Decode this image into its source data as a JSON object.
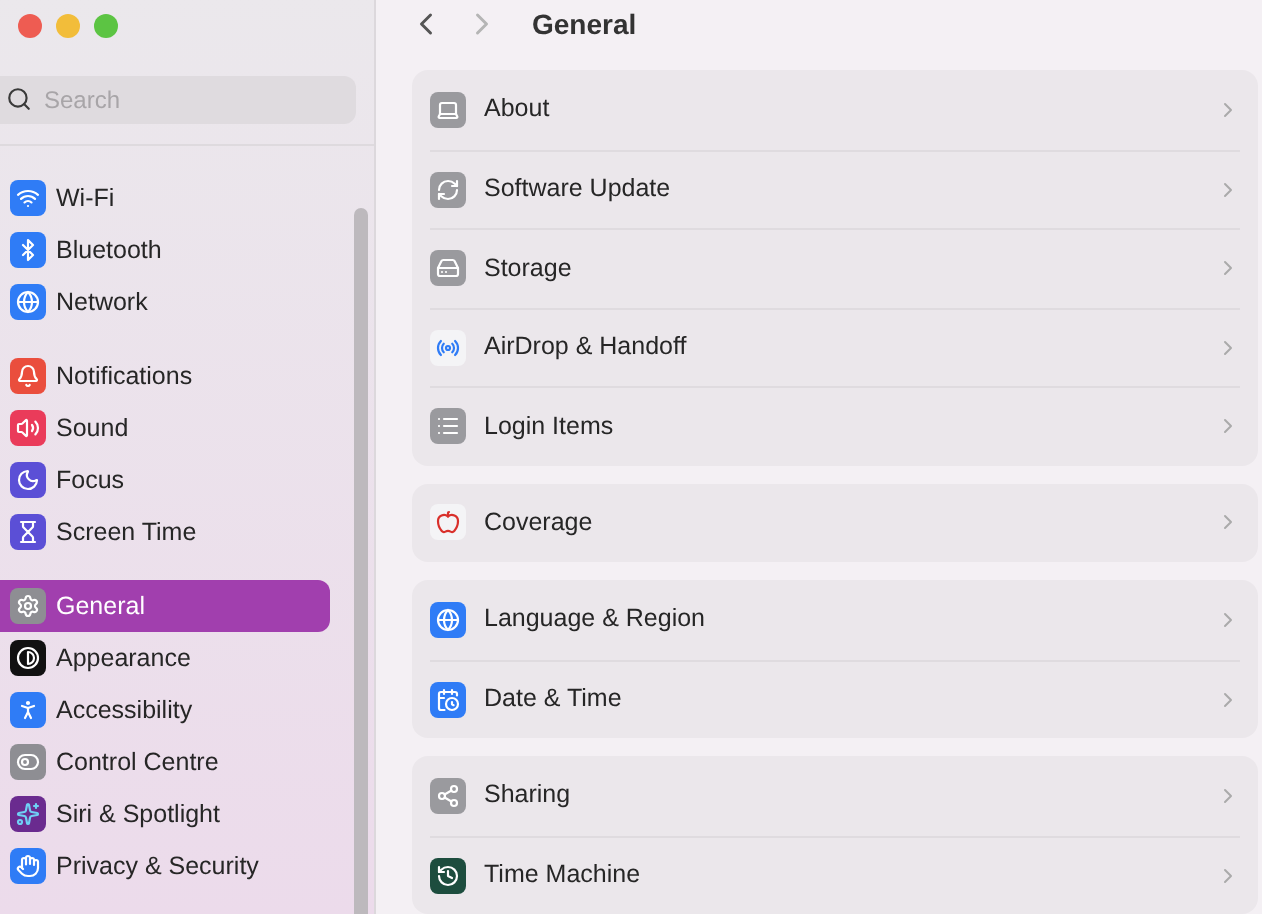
{
  "sidebar": {
    "search": {
      "placeholder": "Search"
    },
    "groups": [
      {
        "items": [
          {
            "label": "Wi-Fi",
            "kind": "wifi",
            "selected": false
          },
          {
            "label": "Bluetooth",
            "kind": "bluetooth",
            "selected": false
          },
          {
            "label": "Network",
            "kind": "network",
            "selected": false
          }
        ]
      },
      {
        "items": [
          {
            "label": "Notifications",
            "kind": "notifications",
            "selected": false
          },
          {
            "label": "Sound",
            "kind": "sound",
            "selected": false
          },
          {
            "label": "Focus",
            "kind": "focus",
            "selected": false
          },
          {
            "label": "Screen Time",
            "kind": "screentime",
            "selected": false
          }
        ]
      },
      {
        "items": [
          {
            "label": "General",
            "kind": "general",
            "selected": true
          },
          {
            "label": "Appearance",
            "kind": "appearance",
            "selected": false
          },
          {
            "label": "Accessibility",
            "kind": "accessibility",
            "selected": false
          },
          {
            "label": "Control Centre",
            "kind": "controlcentre",
            "selected": false
          },
          {
            "label": "Siri & Spotlight",
            "kind": "siri",
            "selected": false
          },
          {
            "label": "Privacy & Security",
            "kind": "privacy",
            "selected": false
          }
        ]
      }
    ]
  },
  "toolbar": {
    "title": "General"
  },
  "groups": [
    {
      "items": [
        {
          "label": "About",
          "kind": "about"
        },
        {
          "label": "Software Update",
          "kind": "update"
        },
        {
          "label": "Storage",
          "kind": "storage"
        },
        {
          "label": "AirDrop & Handoff",
          "kind": "airdrop"
        },
        {
          "label": "Login Items",
          "kind": "login"
        }
      ]
    },
    {
      "items": [
        {
          "label": "Coverage",
          "kind": "coverage"
        }
      ]
    },
    {
      "items": [
        {
          "label": "Language & Region",
          "kind": "language"
        },
        {
          "label": "Date & Time",
          "kind": "datetime"
        }
      ]
    },
    {
      "items": [
        {
          "label": "Sharing",
          "kind": "sharing"
        },
        {
          "label": "Time Machine",
          "kind": "timemachine"
        }
      ]
    }
  ]
}
